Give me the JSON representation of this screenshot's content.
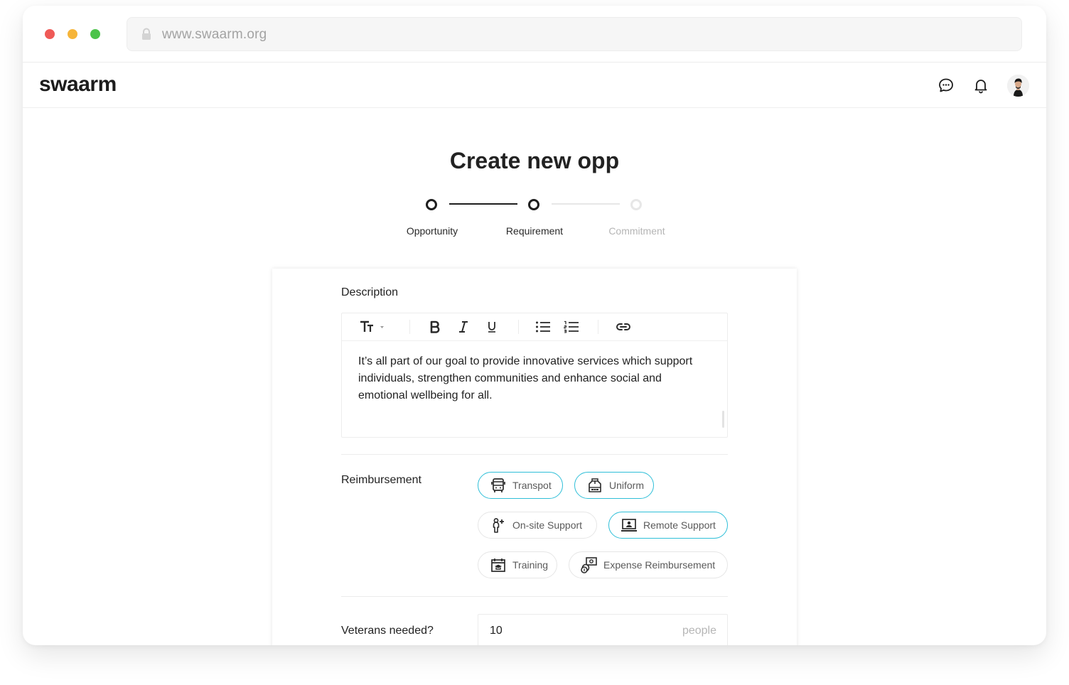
{
  "browser": {
    "url": "www.swaarm.org"
  },
  "header": {
    "logo": "swaarm",
    "icons": [
      "chat-icon",
      "bell-icon",
      "avatar"
    ]
  },
  "page": {
    "title": "Create new opp"
  },
  "stepper": {
    "steps": [
      {
        "label": "Opportunity",
        "state": "complete"
      },
      {
        "label": "Requirement",
        "state": "current"
      },
      {
        "label": "Commitment",
        "state": "upcoming"
      }
    ]
  },
  "description": {
    "label": "Description",
    "toolbar": [
      "text-size",
      "bold",
      "italic",
      "underline",
      "bullet-list",
      "numbered-list",
      "link"
    ],
    "text": "It’s all part of our goal to provide innovative services which support individuals, strengthen communities and enhance social and emotional wellbeing for all."
  },
  "reimbursement": {
    "label": "Reimbursement",
    "options": [
      {
        "label": "Transpot",
        "icon": "bus-icon",
        "selected": true
      },
      {
        "label": "Uniform",
        "icon": "uniform-icon",
        "selected": true
      },
      {
        "label": "On-site Support",
        "icon": "person-plus-icon",
        "selected": false
      },
      {
        "label": "Remote Support",
        "icon": "laptop-person-icon",
        "selected": true
      },
      {
        "label": "Training",
        "icon": "calendar-graduation-icon",
        "selected": false
      },
      {
        "label": "Expense Reimbursement",
        "icon": "money-coins-icon",
        "selected": false
      }
    ]
  },
  "veterans": {
    "label": "Veterans needed?",
    "value": "10",
    "unit": "people"
  },
  "colors": {
    "accent": "#2fbfd8",
    "text": "#222222",
    "muted": "#b5b5b5"
  }
}
